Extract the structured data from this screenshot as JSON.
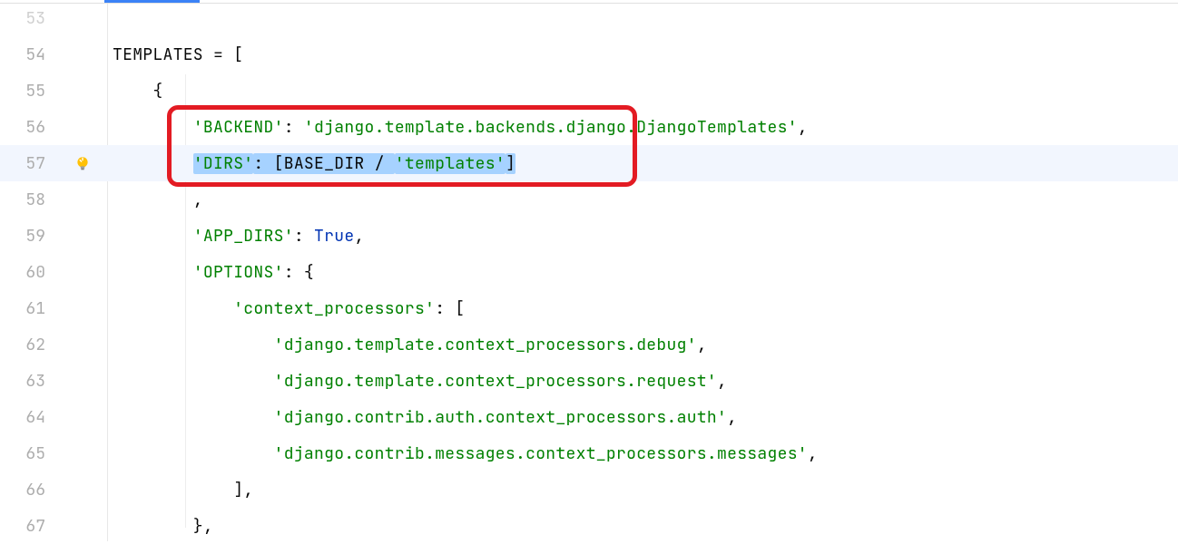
{
  "lines": [
    {
      "num": "53",
      "dim": true,
      "content": "",
      "highlighted": false
    },
    {
      "num": "54",
      "content": [
        {
          "text": "TEMPLATES = [",
          "class": "plain"
        }
      ]
    },
    {
      "num": "55",
      "content": [
        {
          "text": "    {",
          "class": "plain"
        }
      ]
    },
    {
      "num": "56",
      "content": [
        {
          "text": "        ",
          "class": "plain"
        },
        {
          "text": "'BACKEND'",
          "class": "str"
        },
        {
          "text": ": ",
          "class": "plain"
        },
        {
          "text": "'django.template.backends.django.DjangoTemplates'",
          "class": "str"
        },
        {
          "text": ",",
          "class": "plain"
        }
      ]
    },
    {
      "num": "57",
      "highlighted": true,
      "bulb": true,
      "content": [
        {
          "text": "        ",
          "class": "plain"
        },
        {
          "text": "'DIRS'",
          "class": "str",
          "selected": true
        },
        {
          "text": ": [BASE_DIR / ",
          "class": "plain",
          "selected": true
        },
        {
          "text": "'templates'",
          "class": "str",
          "selected": true
        },
        {
          "text": "]",
          "class": "plain",
          "selected": true
        }
      ]
    },
    {
      "num": "58",
      "content": [
        {
          "text": "        ,",
          "class": "plain"
        }
      ]
    },
    {
      "num": "59",
      "content": [
        {
          "text": "        ",
          "class": "plain"
        },
        {
          "text": "'APP_DIRS'",
          "class": "str"
        },
        {
          "text": ": ",
          "class": "plain"
        },
        {
          "text": "True",
          "class": "kw"
        },
        {
          "text": ",",
          "class": "plain"
        }
      ]
    },
    {
      "num": "60",
      "content": [
        {
          "text": "        ",
          "class": "plain"
        },
        {
          "text": "'OPTIONS'",
          "class": "str"
        },
        {
          "text": ": {",
          "class": "plain"
        }
      ]
    },
    {
      "num": "61",
      "content": [
        {
          "text": "            ",
          "class": "plain"
        },
        {
          "text": "'context_processors'",
          "class": "str"
        },
        {
          "text": ": [",
          "class": "plain"
        }
      ]
    },
    {
      "num": "62",
      "content": [
        {
          "text": "                ",
          "class": "plain"
        },
        {
          "text": "'django.template.context_processors.debug'",
          "class": "str"
        },
        {
          "text": ",",
          "class": "plain"
        }
      ]
    },
    {
      "num": "63",
      "content": [
        {
          "text": "                ",
          "class": "plain"
        },
        {
          "text": "'django.template.context_processors.request'",
          "class": "str"
        },
        {
          "text": ",",
          "class": "plain"
        }
      ]
    },
    {
      "num": "64",
      "content": [
        {
          "text": "                ",
          "class": "plain"
        },
        {
          "text": "'django.contrib.auth.context_processors.auth'",
          "class": "str"
        },
        {
          "text": ",",
          "class": "plain"
        }
      ]
    },
    {
      "num": "65",
      "content": [
        {
          "text": "                ",
          "class": "plain"
        },
        {
          "text": "'django.contrib.messages.context_processors.messages'",
          "class": "str"
        },
        {
          "text": ",",
          "class": "plain"
        }
      ]
    },
    {
      "num": "66",
      "content": [
        {
          "text": "            ],",
          "class": "plain"
        }
      ]
    },
    {
      "num": "67",
      "content": [
        {
          "text": "        },",
          "class": "plain"
        }
      ]
    }
  ]
}
